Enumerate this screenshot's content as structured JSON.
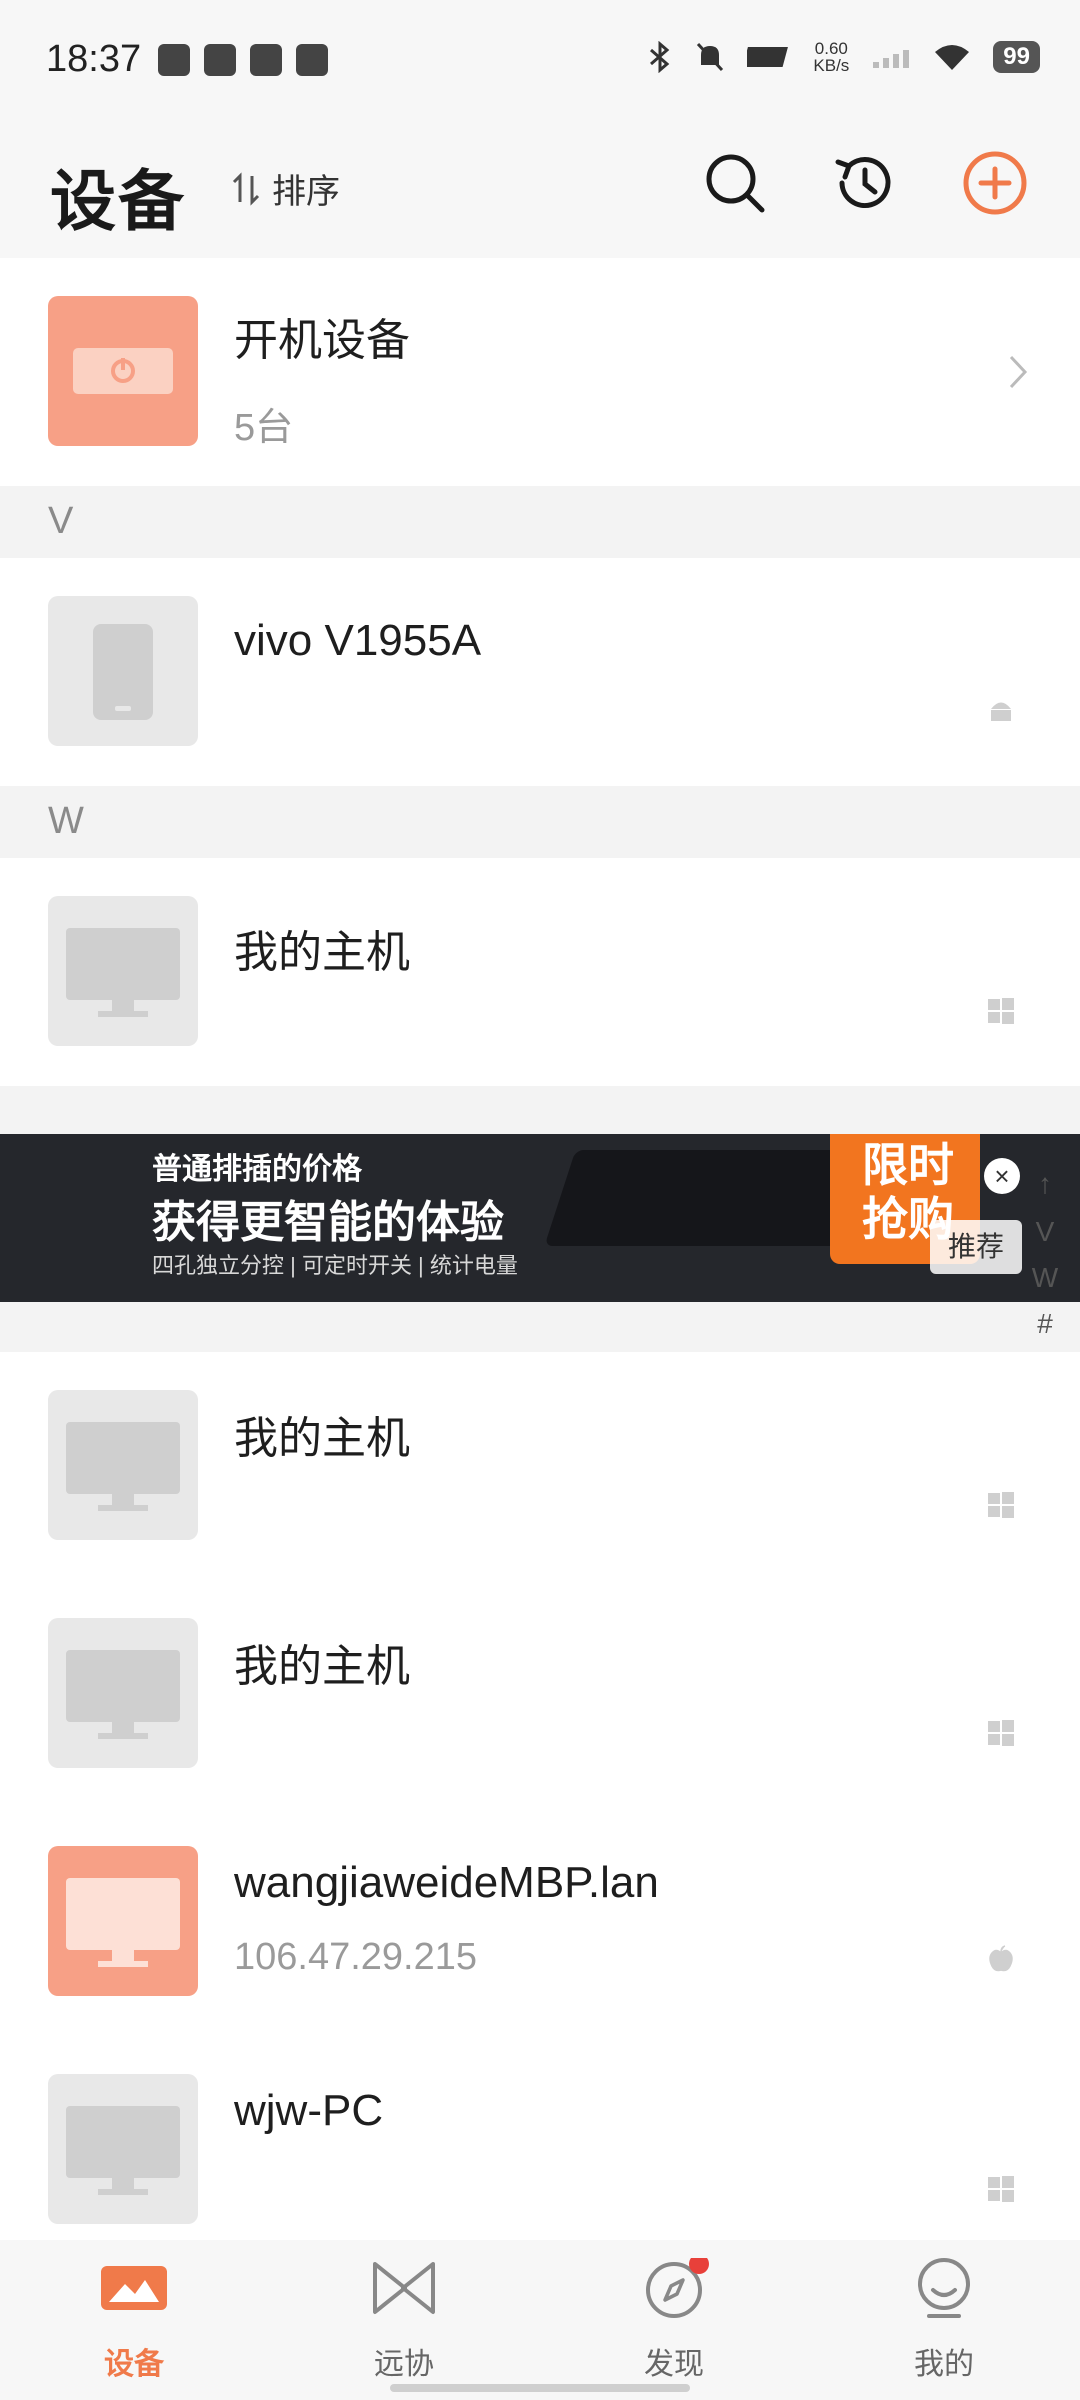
{
  "status_bar": {
    "time": "18:37",
    "net_speed_value": "0.60",
    "net_speed_unit": "KB/s",
    "battery": "99"
  },
  "header": {
    "title": "设备",
    "sort_label": "排序",
    "sort_icon": "sort-icon",
    "icons": [
      "search-icon",
      "history-icon",
      "add-icon"
    ],
    "accent_color": "#f07a4a"
  },
  "power_group": {
    "title": "开机设备",
    "count": "5台"
  },
  "sections": [
    {
      "letter": "V",
      "devices": [
        {
          "name": "vivo V1955A",
          "os": "android-icon",
          "type": "phone"
        }
      ]
    },
    {
      "letter": "W",
      "devices": [
        {
          "name": "我的主机",
          "os": "windows-icon",
          "type": "monitor"
        }
      ]
    }
  ],
  "list_more": [
    {
      "name": "我的主机",
      "os": "windows-icon",
      "type": "monitor"
    },
    {
      "name": "我的主机",
      "os": "windows-icon",
      "type": "monitor"
    },
    {
      "name": "wangjiaweideMBP.lan",
      "sub": "106.47.29.215",
      "os": "apple-icon",
      "type": "monitor-online"
    },
    {
      "name": "wjw-PC",
      "os": "windows-icon",
      "type": "monitor"
    }
  ],
  "banner": {
    "line1": "普通排插的价格",
    "line2": "获得更智能的体验",
    "line3": "四孔独立分控 | 可定时开关 | 统计电量",
    "flash": "限时抢购",
    "tag": "推荐"
  },
  "index_bar": [
    "↑",
    "V",
    "W",
    "#"
  ],
  "bottom_nav": [
    {
      "label": "设备",
      "icon": "devices-icon",
      "active": true
    },
    {
      "label": "远协",
      "icon": "remote-assist-icon",
      "active": false
    },
    {
      "label": "发现",
      "icon": "compass-icon",
      "active": false,
      "badge": true
    },
    {
      "label": "我的",
      "icon": "profile-icon",
      "active": false
    }
  ]
}
